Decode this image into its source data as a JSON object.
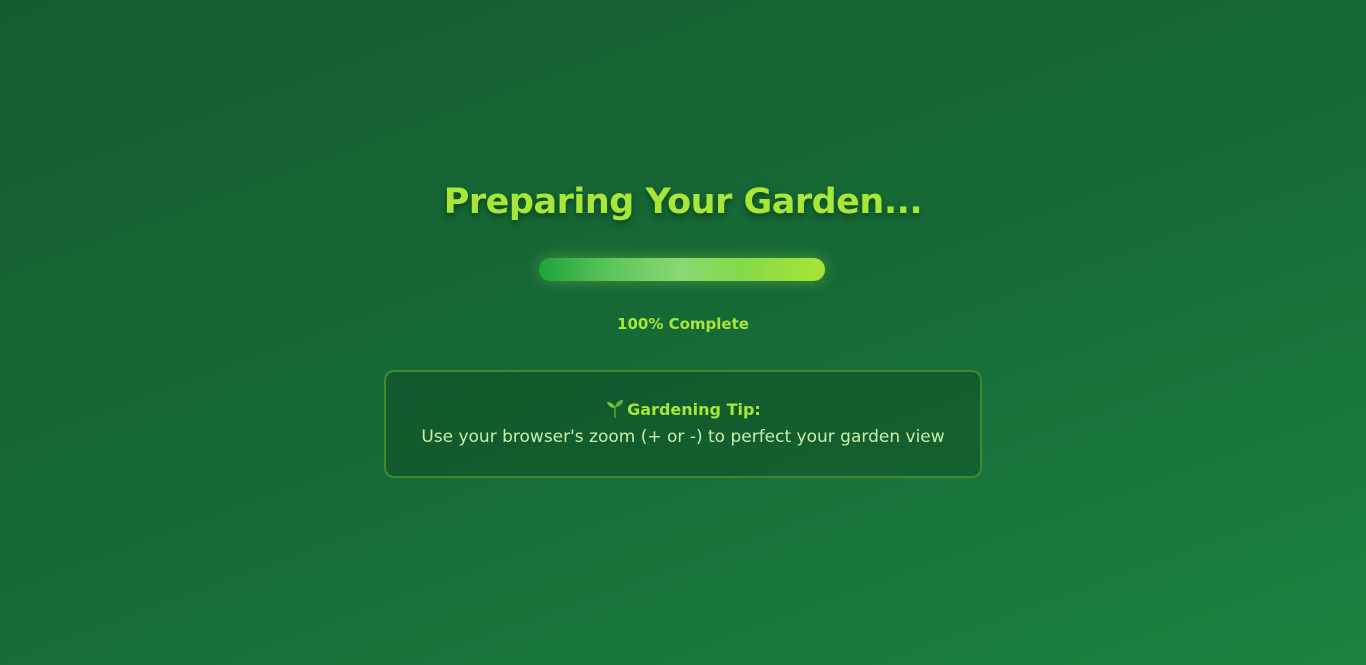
{
  "loader": {
    "title": "Preparing Your Garden...",
    "progress": {
      "percent": 100,
      "label": "100% Complete"
    },
    "tip": {
      "icon": "sprout-icon",
      "heading": "Gardening Tip:",
      "body": "Use your browser's zoom (+ or -) to perfect your garden view"
    }
  },
  "colors": {
    "background": "#166a36",
    "accent": "#a8e63a",
    "tip_text": "#c9f0a8",
    "tip_border": "#3e8a2c"
  }
}
